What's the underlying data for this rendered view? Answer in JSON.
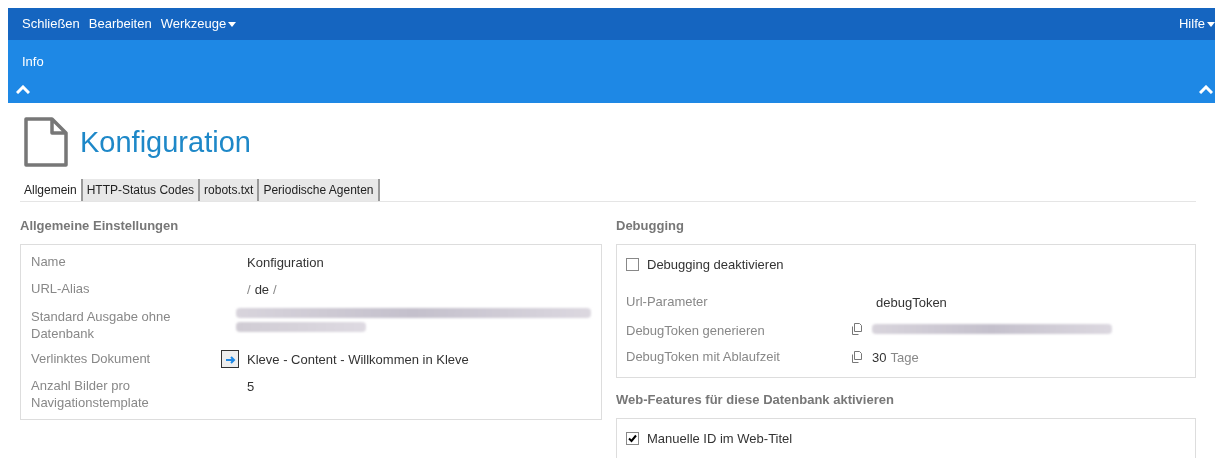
{
  "menu": {
    "items": [
      {
        "label": "Schließen",
        "dropdown": false
      },
      {
        "label": "Bearbeiten",
        "dropdown": false
      },
      {
        "label": "Werkzeuge",
        "dropdown": true
      }
    ],
    "help": {
      "label": "Hilfe",
      "dropdown": true
    }
  },
  "ribbon": {
    "tab": "Info"
  },
  "page": {
    "title": "Konfiguration"
  },
  "tabs": [
    {
      "label": "Allgemein",
      "selected": true
    },
    {
      "label": "HTTP-Status Codes",
      "selected": false
    },
    {
      "label": "robots.txt",
      "selected": false
    },
    {
      "label": "Periodische Agenten",
      "selected": false
    }
  ],
  "general": {
    "title": "Allgemeine Einstellungen",
    "rows": [
      {
        "label": "Name",
        "kind": "text",
        "value": "Konfiguration"
      },
      {
        "label": "URL-Alias",
        "kind": "alias",
        "parts": [
          "/",
          "de",
          "/"
        ]
      },
      {
        "label": "Standard Ausgabe ohne Datenbank",
        "kind": "redacted"
      },
      {
        "label": "Verlinktes Dokument",
        "kind": "link",
        "value": "Kleve - Content - Willkommen in Kleve"
      },
      {
        "label": "Anzahl Bilder pro Navigationstemplate",
        "kind": "text",
        "value": "5"
      }
    ]
  },
  "debugging": {
    "title": "Debugging",
    "checkbox": {
      "label": "Debugging deaktivieren",
      "checked": false
    },
    "rows": [
      {
        "label": "Url-Parameter",
        "kind": "text",
        "value": "debugToken"
      },
      {
        "label": "DebugToken generieren",
        "kind": "copy-redacted"
      },
      {
        "label": "DebugToken mit Ablaufzeit",
        "kind": "copy-days",
        "value": "30",
        "unit": "Tage"
      }
    ]
  },
  "web_features": {
    "title": "Web-Features für diese Datenbank aktivieren",
    "checkbox": {
      "label": "Manuelle ID im Web-Titel",
      "checked": true
    }
  }
}
